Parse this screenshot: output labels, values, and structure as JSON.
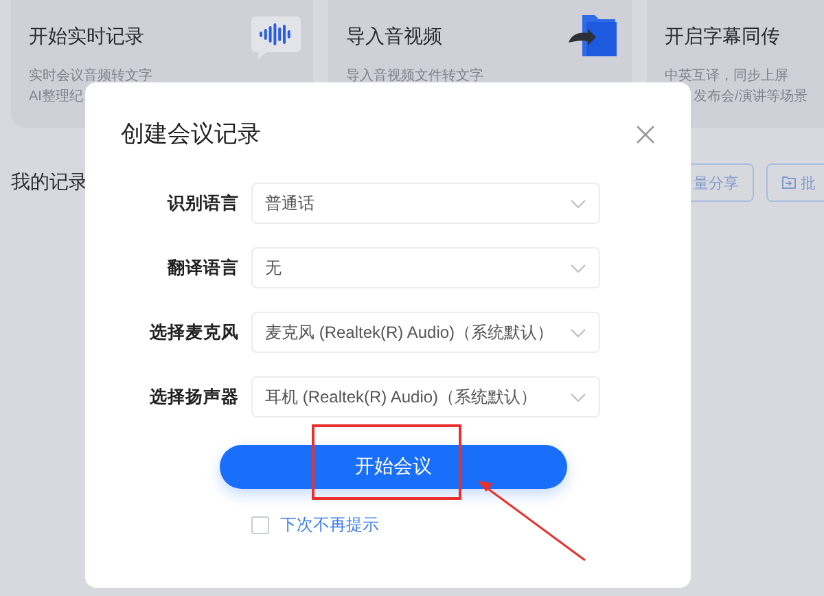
{
  "cards": [
    {
      "title": "开始实时记录",
      "lines": [
        "实时会议音频转文字",
        "AI整理纪"
      ],
      "kind": "wave"
    },
    {
      "title": "导入音视频",
      "lines": [
        "导入音视频文件转文字"
      ],
      "kind": "folder"
    },
    {
      "title": "开启字幕同传",
      "lines": [
        "中英互译，同步上屏",
        "发布会/演讲等场景"
      ],
      "kind": "none"
    }
  ],
  "section_title": "我的记录",
  "toolbar_buttons": [
    {
      "label": "量分享",
      "kind": "text"
    },
    {
      "label": "批",
      "kind": "import"
    }
  ],
  "dialog": {
    "title": "创建会议记录",
    "fields": [
      {
        "label": "识别语言",
        "value": "普通话"
      },
      {
        "label": "翻译语言",
        "value": "无"
      },
      {
        "label": "选择麦克风",
        "value": "麦克风 (Realtek(R) Audio)（系统默认）"
      },
      {
        "label": "选择扬声器",
        "value": "耳机 (Realtek(R) Audio)（系统默认）"
      }
    ],
    "primary_button": "开始会议",
    "checkbox": {
      "label": "下次不再提示",
      "checked": false
    }
  }
}
